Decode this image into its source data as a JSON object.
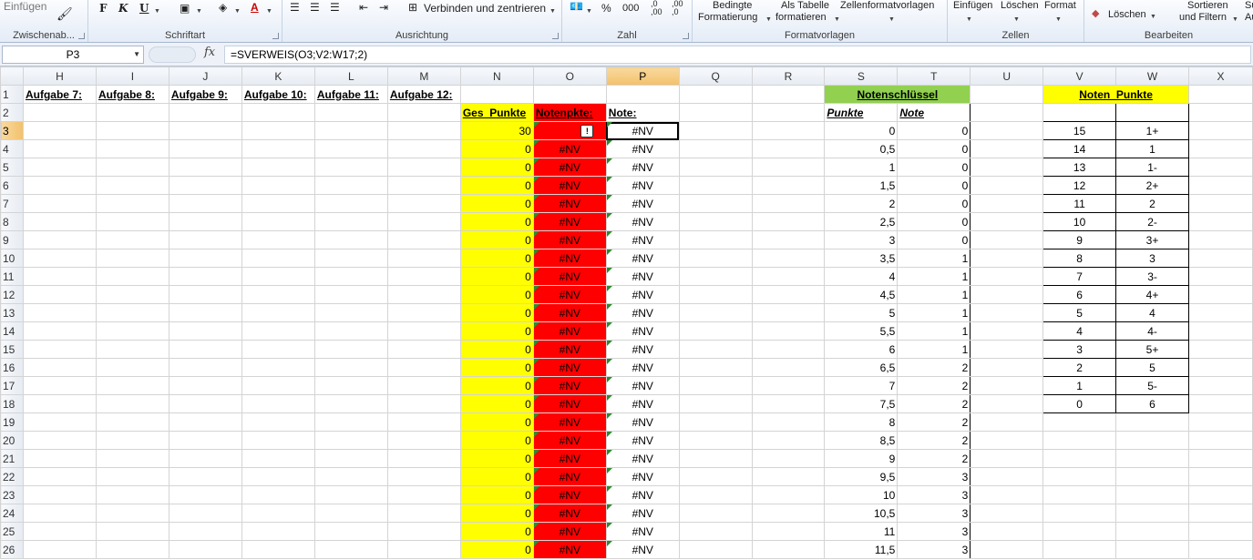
{
  "ribbon": {
    "clipboard": {
      "paste": "Einfügen",
      "label": "Zwischenab..."
    },
    "font": {
      "bold": "F",
      "italic": "K",
      "underline": "U",
      "label": "Schriftart"
    },
    "alignment": {
      "merge": "Verbinden und zentrieren",
      "label": "Ausrichtung"
    },
    "number": {
      "percent": "%",
      "thousands": "000",
      "inc_decimal": ",0 ,00",
      "dec_decimal": ",00 ,0",
      "label": "Zahl"
    },
    "styles": {
      "conditional_1": "Bedingte",
      "conditional_2": "Formatierung",
      "astable_1": "Als Tabelle",
      "astable_2": "formatieren",
      "cellstyles": "Zellenformatvorlagen",
      "label": "Formatvorlagen"
    },
    "cells": {
      "insert": "Einfügen",
      "delete": "Löschen",
      "format": "Format",
      "label": "Zellen"
    },
    "editing": {
      "clear": "Löschen",
      "sort_1": "Sortieren",
      "sort_2": "und Filtern",
      "find": "Su",
      "find2": "Au",
      "label": "Bearbeiten"
    }
  },
  "formula_bar": {
    "name_box": "P3",
    "fx": "fx",
    "formula": "=SVERWEIS(O3;V2:W17;2)"
  },
  "columns": [
    "H",
    "I",
    "J",
    "K",
    "L",
    "M",
    "N",
    "O",
    "P",
    "Q",
    "R",
    "S",
    "T",
    "U",
    "V",
    "W",
    "X"
  ],
  "selected_column": "P",
  "selected_row": 3,
  "headers_row1": {
    "H": "Aufgabe 7:",
    "I": "Aufgabe 8:",
    "J": "Aufgabe 9:",
    "K": "Aufgabe 10:",
    "L": "Aufgabe 11:",
    "M": "Aufgabe 12:",
    "S": "Notenschlüssel",
    "V": "Noten_Punkte"
  },
  "headers_row2": {
    "N": "Ges_Punkte",
    "O": "Notenpkte:",
    "P": "Note:",
    "S": "Punkte",
    "T": "Note"
  },
  "rows": [
    {
      "row": 3,
      "N": "30",
      "O": "",
      "P": "#NV",
      "S": "0",
      "T": "0",
      "V": "15",
      "W": "1+"
    },
    {
      "row": 4,
      "N": "0",
      "O": "#NV",
      "P": "#NV",
      "S": "0,5",
      "T": "0",
      "V": "14",
      "W": "1"
    },
    {
      "row": 5,
      "N": "0",
      "O": "#NV",
      "P": "#NV",
      "S": "1",
      "T": "0",
      "V": "13",
      "W": "1-"
    },
    {
      "row": 6,
      "N": "0",
      "O": "#NV",
      "P": "#NV",
      "S": "1,5",
      "T": "0",
      "V": "12",
      "W": "2+"
    },
    {
      "row": 7,
      "N": "0",
      "O": "#NV",
      "P": "#NV",
      "S": "2",
      "T": "0",
      "V": "11",
      "W": "2"
    },
    {
      "row": 8,
      "N": "0",
      "O": "#NV",
      "P": "#NV",
      "S": "2,5",
      "T": "0",
      "V": "10",
      "W": "2-"
    },
    {
      "row": 9,
      "N": "0",
      "O": "#NV",
      "P": "#NV",
      "S": "3",
      "T": "0",
      "V": "9",
      "W": "3+"
    },
    {
      "row": 10,
      "N": "0",
      "O": "#NV",
      "P": "#NV",
      "S": "3,5",
      "T": "1",
      "V": "8",
      "W": "3"
    },
    {
      "row": 11,
      "N": "0",
      "O": "#NV",
      "P": "#NV",
      "S": "4",
      "T": "1",
      "V": "7",
      "W": "3-"
    },
    {
      "row": 12,
      "N": "0",
      "O": "#NV",
      "P": "#NV",
      "S": "4,5",
      "T": "1",
      "V": "6",
      "W": "4+"
    },
    {
      "row": 13,
      "N": "0",
      "O": "#NV",
      "P": "#NV",
      "S": "5",
      "T": "1",
      "V": "5",
      "W": "4"
    },
    {
      "row": 14,
      "N": "0",
      "O": "#NV",
      "P": "#NV",
      "S": "5,5",
      "T": "1",
      "V": "4",
      "W": "4-"
    },
    {
      "row": 15,
      "N": "0",
      "O": "#NV",
      "P": "#NV",
      "S": "6",
      "T": "1",
      "V": "3",
      "W": "5+"
    },
    {
      "row": 16,
      "N": "0",
      "O": "#NV",
      "P": "#NV",
      "S": "6,5",
      "T": "2",
      "V": "2",
      "W": "5"
    },
    {
      "row": 17,
      "N": "0",
      "O": "#NV",
      "P": "#NV",
      "S": "7",
      "T": "2",
      "V": "1",
      "W": "5-"
    },
    {
      "row": 18,
      "N": "0",
      "O": "#NV",
      "P": "#NV",
      "S": "7,5",
      "T": "2",
      "V": "0",
      "W": "6"
    },
    {
      "row": 19,
      "N": "0",
      "O": "#NV",
      "P": "#NV",
      "S": "8",
      "T": "2",
      "V": "",
      "W": ""
    },
    {
      "row": 20,
      "N": "0",
      "O": "#NV",
      "P": "#NV",
      "S": "8,5",
      "T": "2",
      "V": "",
      "W": ""
    },
    {
      "row": 21,
      "N": "0",
      "O": "#NV",
      "P": "#NV",
      "S": "9",
      "T": "2",
      "V": "",
      "W": ""
    },
    {
      "row": 22,
      "N": "0",
      "O": "#NV",
      "P": "#NV",
      "S": "9,5",
      "T": "3",
      "V": "",
      "W": ""
    },
    {
      "row": 23,
      "N": "0",
      "O": "#NV",
      "P": "#NV",
      "S": "10",
      "T": "3",
      "V": "",
      "W": ""
    },
    {
      "row": 24,
      "N": "0",
      "O": "#NV",
      "P": "#NV",
      "S": "10,5",
      "T": "3",
      "V": "",
      "W": ""
    },
    {
      "row": 25,
      "N": "0",
      "O": "#NV",
      "P": "#NV",
      "S": "11",
      "T": "3",
      "V": "",
      "W": ""
    },
    {
      "row": 26,
      "N": "0",
      "O": "#NV",
      "P": "#NV",
      "S": "11,5",
      "T": "3",
      "V": "",
      "W": ""
    }
  ],
  "colors": {
    "yellow": "#ffff00",
    "red": "#ff0000",
    "green": "#92d050",
    "selection": "#f2c16b"
  },
  "icons": {
    "format_painter": "brush-icon",
    "error_indicator": "warning-icon"
  }
}
